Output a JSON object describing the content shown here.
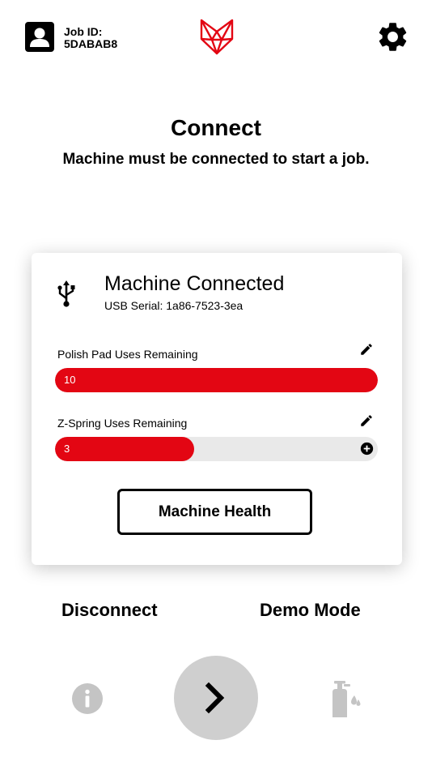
{
  "header": {
    "job_id_label": "Job ID:",
    "job_id_value": "5DABAB8"
  },
  "page": {
    "title": "Connect",
    "subtitle": "Machine must be connected to start a job."
  },
  "card": {
    "status_title": "Machine Connected",
    "serial": "USB Serial: 1a86-7523-3ea",
    "meters": [
      {
        "label": "Polish Pad Uses Remaining",
        "value": "10",
        "fill_fraction": 1.0
      },
      {
        "label": "Z-Spring Uses Remaining",
        "value": "3",
        "fill_fraction": 0.43
      }
    ],
    "health_button": "Machine Health"
  },
  "actions": {
    "disconnect": "Disconnect",
    "demo_mode": "Demo Mode"
  },
  "colors": {
    "accent": "#e30613",
    "bar_track": "#e9e9e9",
    "nav_gray": "#cfcfcf",
    "icon_gray": "#c4c4c4"
  },
  "icons": [
    "user-icon",
    "fox-logo",
    "gear-icon",
    "usb-icon",
    "edit-icon",
    "plus-icon",
    "info-icon",
    "chevron-right-icon",
    "spray-bottle-icon"
  ]
}
